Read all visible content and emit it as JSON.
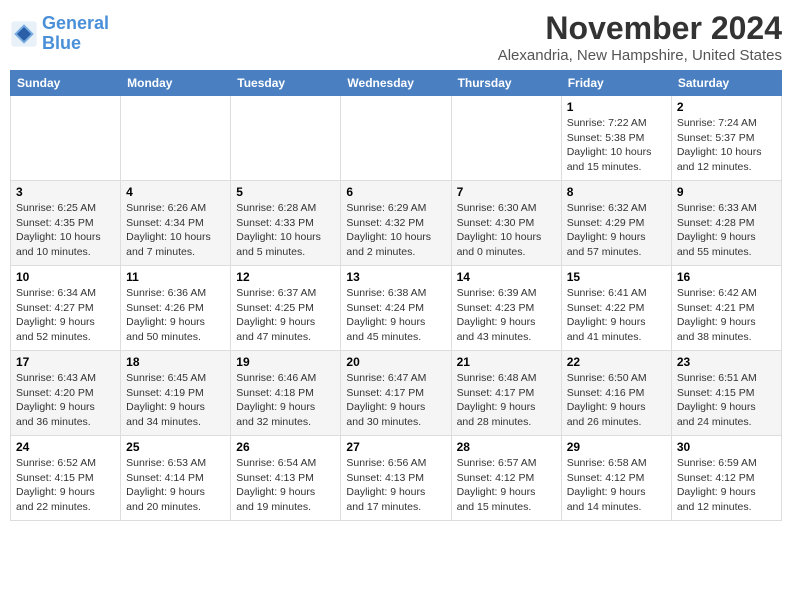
{
  "logo": {
    "line1": "General",
    "line2": "Blue"
  },
  "title": "November 2024",
  "location": "Alexandria, New Hampshire, United States",
  "weekdays": [
    "Sunday",
    "Monday",
    "Tuesday",
    "Wednesday",
    "Thursday",
    "Friday",
    "Saturday"
  ],
  "weeks": [
    [
      {
        "day": "",
        "info": ""
      },
      {
        "day": "",
        "info": ""
      },
      {
        "day": "",
        "info": ""
      },
      {
        "day": "",
        "info": ""
      },
      {
        "day": "",
        "info": ""
      },
      {
        "day": "1",
        "info": "Sunrise: 7:22 AM\nSunset: 5:38 PM\nDaylight: 10 hours and 15 minutes."
      },
      {
        "day": "2",
        "info": "Sunrise: 7:24 AM\nSunset: 5:37 PM\nDaylight: 10 hours and 12 minutes."
      }
    ],
    [
      {
        "day": "3",
        "info": "Sunrise: 6:25 AM\nSunset: 4:35 PM\nDaylight: 10 hours and 10 minutes."
      },
      {
        "day": "4",
        "info": "Sunrise: 6:26 AM\nSunset: 4:34 PM\nDaylight: 10 hours and 7 minutes."
      },
      {
        "day": "5",
        "info": "Sunrise: 6:28 AM\nSunset: 4:33 PM\nDaylight: 10 hours and 5 minutes."
      },
      {
        "day": "6",
        "info": "Sunrise: 6:29 AM\nSunset: 4:32 PM\nDaylight: 10 hours and 2 minutes."
      },
      {
        "day": "7",
        "info": "Sunrise: 6:30 AM\nSunset: 4:30 PM\nDaylight: 10 hours and 0 minutes."
      },
      {
        "day": "8",
        "info": "Sunrise: 6:32 AM\nSunset: 4:29 PM\nDaylight: 9 hours and 57 minutes."
      },
      {
        "day": "9",
        "info": "Sunrise: 6:33 AM\nSunset: 4:28 PM\nDaylight: 9 hours and 55 minutes."
      }
    ],
    [
      {
        "day": "10",
        "info": "Sunrise: 6:34 AM\nSunset: 4:27 PM\nDaylight: 9 hours and 52 minutes."
      },
      {
        "day": "11",
        "info": "Sunrise: 6:36 AM\nSunset: 4:26 PM\nDaylight: 9 hours and 50 minutes."
      },
      {
        "day": "12",
        "info": "Sunrise: 6:37 AM\nSunset: 4:25 PM\nDaylight: 9 hours and 47 minutes."
      },
      {
        "day": "13",
        "info": "Sunrise: 6:38 AM\nSunset: 4:24 PM\nDaylight: 9 hours and 45 minutes."
      },
      {
        "day": "14",
        "info": "Sunrise: 6:39 AM\nSunset: 4:23 PM\nDaylight: 9 hours and 43 minutes."
      },
      {
        "day": "15",
        "info": "Sunrise: 6:41 AM\nSunset: 4:22 PM\nDaylight: 9 hours and 41 minutes."
      },
      {
        "day": "16",
        "info": "Sunrise: 6:42 AM\nSunset: 4:21 PM\nDaylight: 9 hours and 38 minutes."
      }
    ],
    [
      {
        "day": "17",
        "info": "Sunrise: 6:43 AM\nSunset: 4:20 PM\nDaylight: 9 hours and 36 minutes."
      },
      {
        "day": "18",
        "info": "Sunrise: 6:45 AM\nSunset: 4:19 PM\nDaylight: 9 hours and 34 minutes."
      },
      {
        "day": "19",
        "info": "Sunrise: 6:46 AM\nSunset: 4:18 PM\nDaylight: 9 hours and 32 minutes."
      },
      {
        "day": "20",
        "info": "Sunrise: 6:47 AM\nSunset: 4:17 PM\nDaylight: 9 hours and 30 minutes."
      },
      {
        "day": "21",
        "info": "Sunrise: 6:48 AM\nSunset: 4:17 PM\nDaylight: 9 hours and 28 minutes."
      },
      {
        "day": "22",
        "info": "Sunrise: 6:50 AM\nSunset: 4:16 PM\nDaylight: 9 hours and 26 minutes."
      },
      {
        "day": "23",
        "info": "Sunrise: 6:51 AM\nSunset: 4:15 PM\nDaylight: 9 hours and 24 minutes."
      }
    ],
    [
      {
        "day": "24",
        "info": "Sunrise: 6:52 AM\nSunset: 4:15 PM\nDaylight: 9 hours and 22 minutes."
      },
      {
        "day": "25",
        "info": "Sunrise: 6:53 AM\nSunset: 4:14 PM\nDaylight: 9 hours and 20 minutes."
      },
      {
        "day": "26",
        "info": "Sunrise: 6:54 AM\nSunset: 4:13 PM\nDaylight: 9 hours and 19 minutes."
      },
      {
        "day": "27",
        "info": "Sunrise: 6:56 AM\nSunset: 4:13 PM\nDaylight: 9 hours and 17 minutes."
      },
      {
        "day": "28",
        "info": "Sunrise: 6:57 AM\nSunset: 4:12 PM\nDaylight: 9 hours and 15 minutes."
      },
      {
        "day": "29",
        "info": "Sunrise: 6:58 AM\nSunset: 4:12 PM\nDaylight: 9 hours and 14 minutes."
      },
      {
        "day": "30",
        "info": "Sunrise: 6:59 AM\nSunset: 4:12 PM\nDaylight: 9 hours and 12 minutes."
      }
    ]
  ]
}
